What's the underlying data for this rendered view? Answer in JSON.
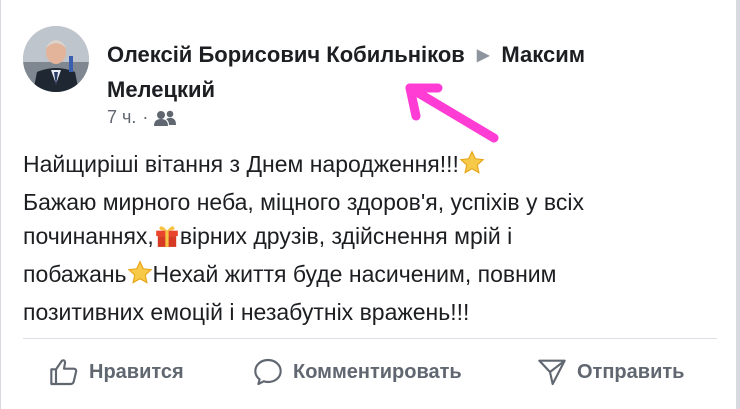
{
  "post": {
    "author": "Олексій Борисович Кобильніков",
    "separator_icon": "triangle-right-icon",
    "recipient_line1": "Максим",
    "recipient_line2": "Мелецкий",
    "time": "7 ч.",
    "dot": "·",
    "audience_icon": "friends-icon",
    "lines": [
      "Найщиріші вітання з Днем народження!!!",
      "Бажаю мирного неба, міцного здоров'я, успіхів у всіх",
      "починаннях,",
      "вірних друзів, здійснення мрій і",
      "побажань",
      "Нехай життя буде насиченим, повним",
      "позитивних емоцій і незабутніх вражень!!!"
    ]
  },
  "actions": {
    "like": "Нравится",
    "comment": "Комментировать",
    "share": "Отправить"
  },
  "colors": {
    "annotation_arrow": "#ff3dd4",
    "text": "#1c1e21",
    "muted": "#606770"
  }
}
